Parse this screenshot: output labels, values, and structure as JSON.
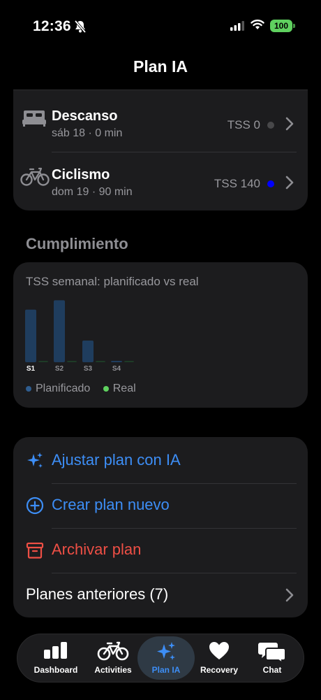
{
  "status_bar": {
    "time": "12:36",
    "battery": "100"
  },
  "nav": {
    "title": "Plan IA"
  },
  "workouts": [
    {
      "title": "Descanso",
      "subtitle": "sáb 18 · 0 min",
      "tss": "TSS 0",
      "dot_color": "#48484a"
    },
    {
      "title": "Ciclismo",
      "subtitle": "dom 19 · 90 min",
      "tss": "TSS 140",
      "dot_color": "#0000ff"
    }
  ],
  "section": {
    "title": "Cumplimiento"
  },
  "chart_card": {
    "title": "TSS semanal: planificado vs real",
    "legend": [
      {
        "label": "Planificado",
        "color": "#2f5d8f"
      },
      {
        "label": "Real",
        "color": "#5fd15f"
      }
    ]
  },
  "chart_data": {
    "type": "bar",
    "title": "TSS semanal: planificado vs real",
    "categories": [
      "S1",
      "S2",
      "S3",
      "S4"
    ],
    "series": [
      {
        "name": "Planificado",
        "values": [
          340,
          400,
          140,
          5
        ]
      },
      {
        "name": "Real",
        "values": [
          5,
          5,
          5,
          5
        ]
      }
    ],
    "active_category": "S1",
    "colors": {
      "Planificado": "#1f3d5e",
      "Real": "#1e3b26"
    },
    "ylim": [
      0,
      420
    ],
    "legend": "bottom-left"
  },
  "actions": {
    "adjust": "Ajustar plan con IA",
    "create": "Crear plan nuevo",
    "archive": "Archivar plan",
    "previous": "Planes anteriores (7)"
  },
  "tabs": [
    {
      "label": "Dashboard",
      "icon": "bar-chart-icon"
    },
    {
      "label": "Activities",
      "icon": "bicycle-icon"
    },
    {
      "label": "Plan IA",
      "icon": "sparkles-icon",
      "active": true
    },
    {
      "label": "Recovery",
      "icon": "heart-icon"
    },
    {
      "label": "Chat",
      "icon": "chat-bubbles-icon"
    }
  ],
  "colors": {
    "accent": "#3d8ef6",
    "danger": "#ee4f45",
    "card": "#1c1c1e"
  }
}
